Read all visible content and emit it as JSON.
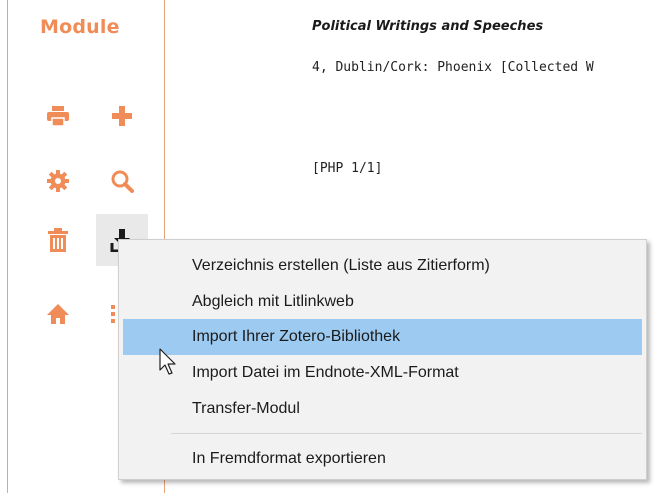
{
  "sidebar": {
    "title": "Module",
    "tools": [
      {
        "icon": "printer-icon"
      },
      {
        "icon": "plus-icon"
      },
      {
        "icon": "gear-icon"
      },
      {
        "icon": "search-icon"
      },
      {
        "icon": "trash-icon"
      },
      {
        "icon": "download-icon"
      },
      {
        "icon": "home-icon"
      },
      {
        "icon": "list-icon"
      }
    ],
    "accent_color": "#f08c57"
  },
  "content": {
    "title": "Political Writings and Speeches",
    "line": "4, Dublin/Cork: Phoenix [Collected W",
    "page_ref": "[PHP 1/1]"
  },
  "context_menu": {
    "items": [
      {
        "label": "Verzeichnis erstellen (Liste aus Zitierform)"
      },
      {
        "label": "Abgleich mit Litlinkweb"
      },
      {
        "label": "Import Ihrer Zotero-Bibliothek",
        "highlighted": true
      },
      {
        "label": "Import Datei im Endnote-XML-Format"
      },
      {
        "label": "Transfer-Modul"
      },
      {
        "label": "In Fremdformat exportieren"
      }
    ],
    "highlight_color": "#9dcaf0"
  }
}
